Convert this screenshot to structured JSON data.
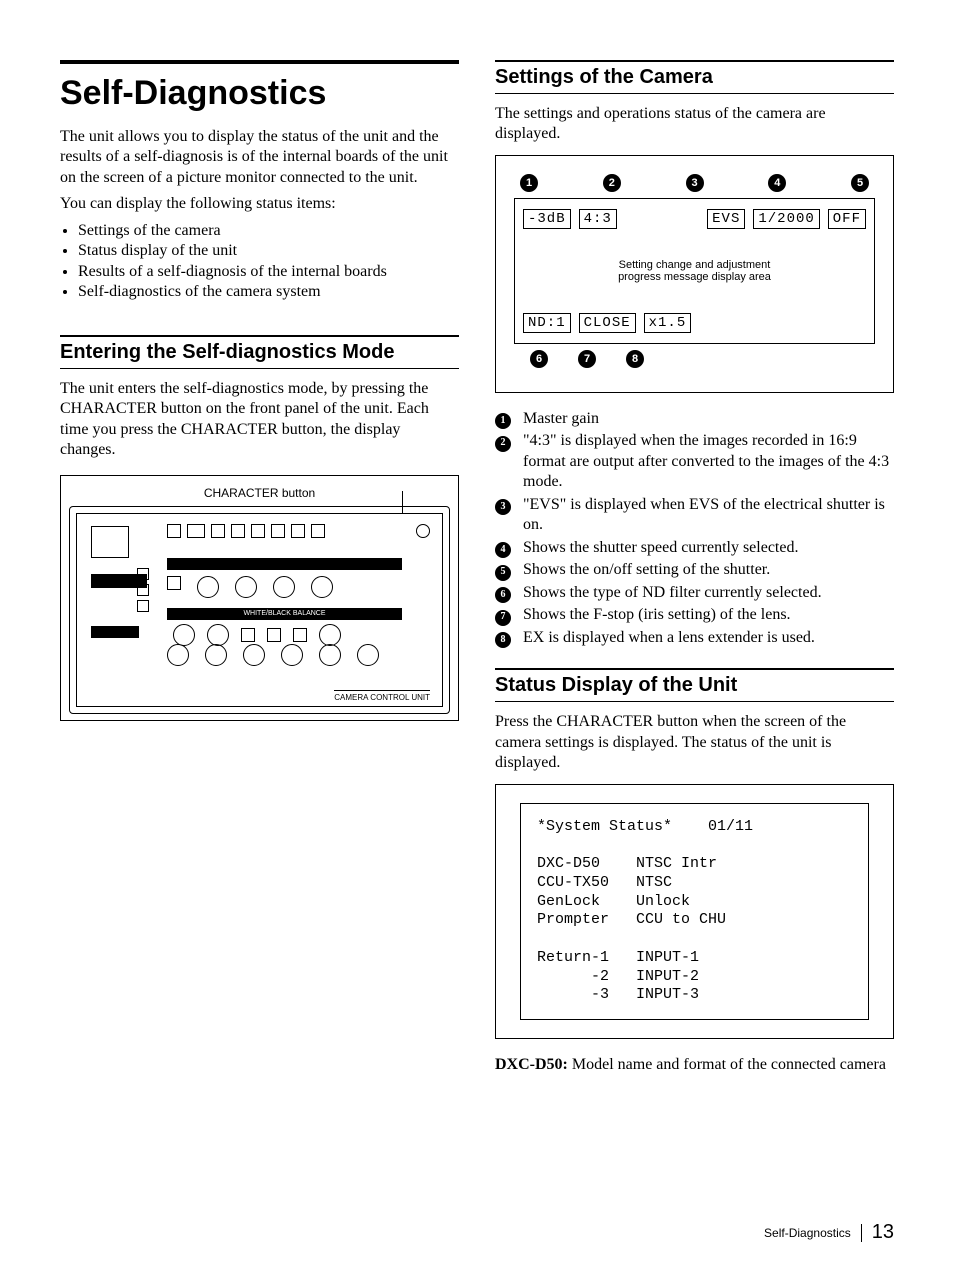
{
  "page": {
    "footer_section": "Self-Diagnostics",
    "page_number": "13"
  },
  "left": {
    "title": "Self-Diagnostics",
    "intro1": "The unit allows you to display the status of the unit and the results of a self-diagnosis is of the internal boards of the unit on the screen of a picture monitor connected to the unit.",
    "intro2": "You can display the following status items:",
    "bullets": [
      "Settings of the camera",
      "Status display of the unit",
      "Results of a self-diagnosis of the internal boards",
      "Self-diagnostics of the camera system"
    ],
    "h2": "Entering the Self-diagnostics Mode",
    "body1": "The unit enters the self-diagnostics mode, by pressing the CHARACTER button on the front panel of the unit. Each time you press the CHARACTER button, the display changes.",
    "fig_caption": "CHARACTER button",
    "fig_foot": "CAMERA CONTROL UNIT",
    "fig_labels": {
      "wb": "WHITE/BLACK BALANCE"
    }
  },
  "right": {
    "h2a": "Settings of the Camera",
    "pa": "The settings and operations status of the camera are displayed.",
    "cam_screen": {
      "top": [
        "-3dB",
        "4:3",
        "EVS",
        "1/2000",
        "OFF"
      ],
      "mid1": "Setting change and adjustment",
      "mid2": "progress message display area",
      "bottom": [
        "ND:1",
        "CLOSE",
        "x1.5"
      ]
    },
    "defs": [
      "Master gain",
      "\"4:3\" is displayed when the images recorded in 16:9 format are output after converted to the images of the 4:3 mode.",
      "\"EVS\" is displayed when EVS of the electrical shutter is on.",
      "Shows the shutter speed currently selected.",
      "Shows the on/off setting of the shutter.",
      "Shows the type of ND filter currently selected.",
      "Shows the F-stop (iris setting) of the lens.",
      "EX is displayed when a lens extender is used."
    ],
    "h2b": "Status Display of the Unit",
    "pb": "Press the CHARACTER button when the screen of the camera settings is displayed. The status of the unit is displayed.",
    "sys_screen": "*System Status*    01/11\n\nDXC-D50    NTSC Intr\nCCU-TX50   NTSC\nGenLock    Unlock\nPrompter   CCU to CHU\n\nReturn-1   INPUT-1\n      -2   INPUT-2\n      -3   INPUT-3",
    "note_bold": "DXC-D50:",
    "note_rest": " Model name and format of the connected camera"
  }
}
